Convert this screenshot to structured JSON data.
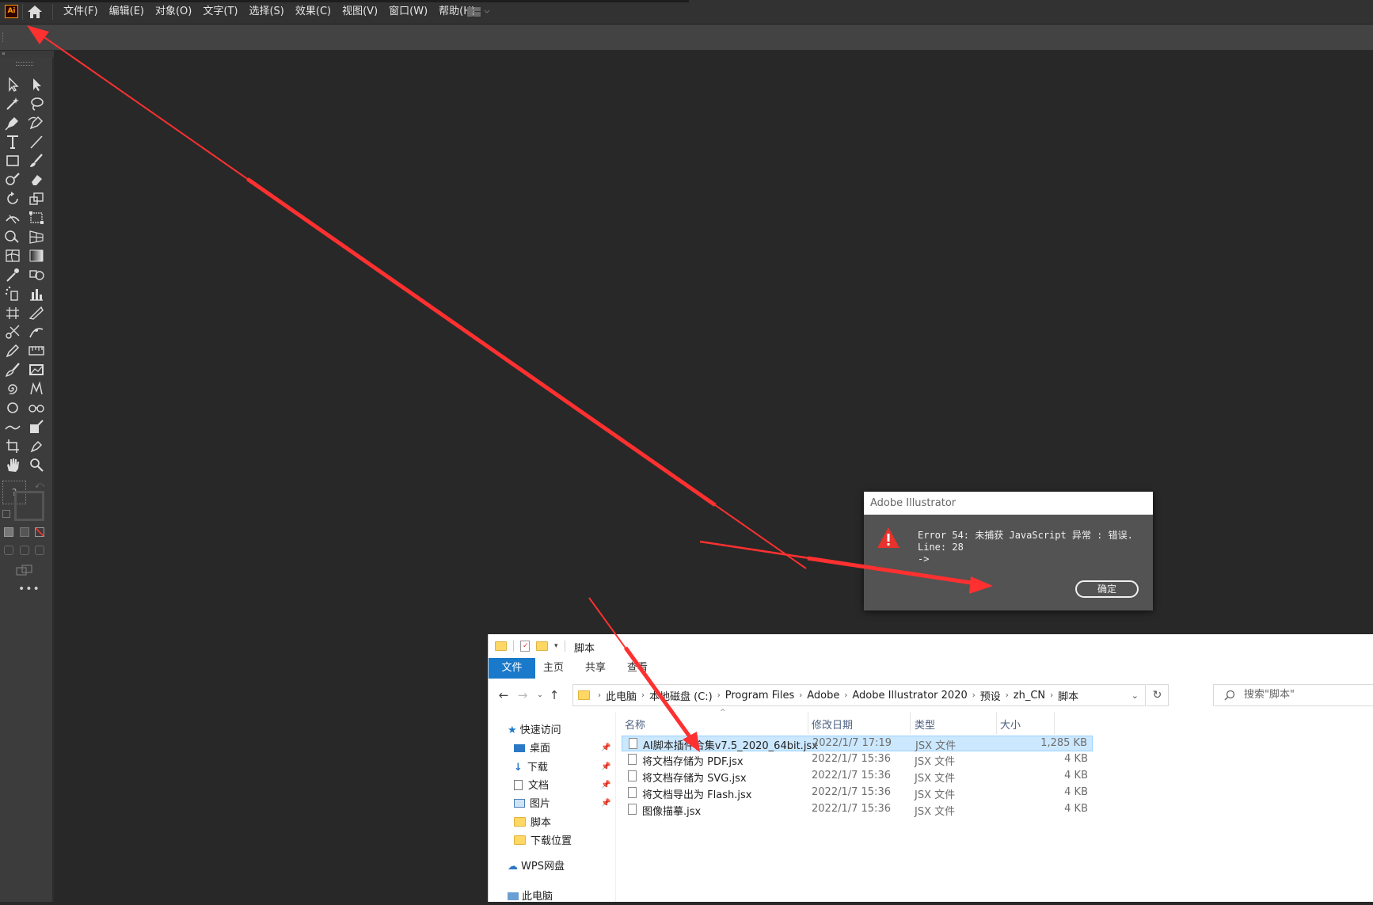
{
  "app": {
    "logo_text": "Ai",
    "menu": [
      "文件(F)",
      "编辑(E)",
      "对象(O)",
      "文字(T)",
      "选择(S)",
      "效果(C)",
      "视图(V)",
      "窗口(W)",
      "帮助(H)"
    ]
  },
  "dialog": {
    "title": "Adobe Illustrator",
    "message_line1": "Error 54: 未捕获 JavaScript 异常 : 错误.",
    "message_line2": "Line: 28",
    "message_line3": "->",
    "ok_label": "确定"
  },
  "explorer": {
    "title": "脚本",
    "ribbon_tabs": [
      "文件",
      "主页",
      "共享",
      "查看"
    ],
    "breadcrumb": [
      "此电脑",
      "本地磁盘 (C:)",
      "Program Files",
      "Adobe",
      "Adobe Illustrator 2020",
      "预设",
      "zh_CN",
      "脚本"
    ],
    "search_placeholder": "搜索\"脚本\"",
    "nav": {
      "quick_access": "快速访问",
      "items": [
        "桌面",
        "下载",
        "文档",
        "图片",
        "脚本",
        "下载位置"
      ],
      "wps": "WPS网盘",
      "this_pc": "此电脑"
    },
    "columns": [
      "名称",
      "修改日期",
      "类型",
      "大小"
    ],
    "files": [
      {
        "name": "AI脚本插件合集v7.5_2020_64bit.jsx",
        "date": "2022/1/7 17:19",
        "type": "JSX 文件",
        "size": "1,285 KB"
      },
      {
        "name": "将文档存储为 PDF.jsx",
        "date": "2022/1/7 15:36",
        "type": "JSX 文件",
        "size": "4 KB"
      },
      {
        "name": "将文档存储为 SVG.jsx",
        "date": "2022/1/7 15:36",
        "type": "JSX 文件",
        "size": "4 KB"
      },
      {
        "name": "将文档导出为 Flash.jsx",
        "date": "2022/1/7 15:36",
        "type": "JSX 文件",
        "size": "4 KB"
      },
      {
        "name": "图像描摹.jsx",
        "date": "2022/1/7 15:36",
        "type": "JSX 文件",
        "size": "4 KB"
      }
    ]
  },
  "colors": {
    "annotation_arrow": "#ff3030",
    "ribbon_file_tab": "#1979ca",
    "selection": "#cce8ff"
  }
}
